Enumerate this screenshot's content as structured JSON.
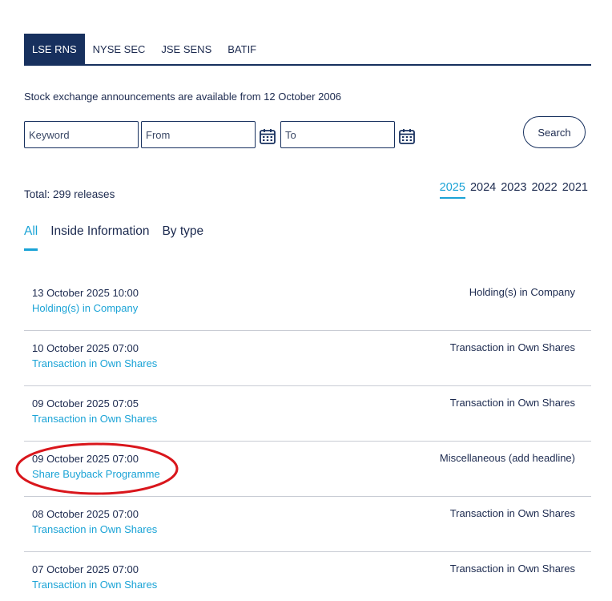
{
  "exchange_tabs": [
    {
      "label": "LSE RNS",
      "active": true
    },
    {
      "label": "NYSE SEC",
      "active": false
    },
    {
      "label": "JSE SENS",
      "active": false
    },
    {
      "label": "BATIF",
      "active": false
    }
  ],
  "notice": "Stock exchange announcements are available from 12 October 2006",
  "search": {
    "keyword_placeholder": "Keyword",
    "from_placeholder": "From",
    "to_placeholder": "To",
    "button_label": "Search"
  },
  "total": "Total: 299 releases",
  "years": [
    {
      "label": "2025",
      "active": true
    },
    {
      "label": "2024",
      "active": false
    },
    {
      "label": "2023",
      "active": false
    },
    {
      "label": "2022",
      "active": false
    },
    {
      "label": "2021",
      "active": false
    }
  ],
  "filters": [
    {
      "label": "All",
      "active": true
    },
    {
      "label": "Inside Information",
      "active": false
    },
    {
      "label": "By type",
      "active": false
    }
  ],
  "releases": [
    {
      "date": "13 October 2025 10:00",
      "title": "Holding(s) in Company",
      "type": "Holding(s) in Company"
    },
    {
      "date": "10 October 2025 07:00",
      "title": "Transaction in Own Shares",
      "type": "Transaction in Own Shares"
    },
    {
      "date": "09 October 2025 07:05",
      "title": "Transaction in Own Shares",
      "type": "Transaction in Own Shares"
    },
    {
      "date": "09 October 2025 07:00",
      "title": "Share Buyback Programme",
      "type": "Miscellaneous (add headline)"
    },
    {
      "date": "08 October 2025 07:00",
      "title": "Transaction in Own Shares",
      "type": "Transaction in Own Shares"
    },
    {
      "date": "07 October 2025 07:00",
      "title": "Transaction in Own Shares",
      "type": "Transaction in Own Shares"
    }
  ],
  "colors": {
    "navy": "#17305e",
    "accent": "#1aa3d6",
    "highlight": "#d9161c"
  }
}
